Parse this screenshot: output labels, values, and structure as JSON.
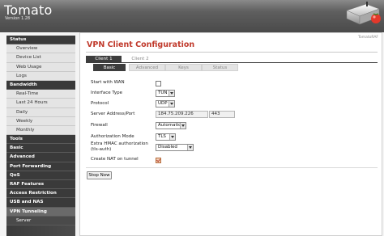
{
  "header": {
    "title": "Tomato",
    "version": "Version 1.28"
  },
  "sidebar": {
    "items": [
      {
        "label": "Status",
        "kind": "head"
      },
      {
        "label": "Overview",
        "kind": "sub"
      },
      {
        "label": "Device List",
        "kind": "sub"
      },
      {
        "label": "Web Usage",
        "kind": "sub"
      },
      {
        "label": "Logs",
        "kind": "sub"
      },
      {
        "label": "Bandwidth",
        "kind": "head"
      },
      {
        "label": "Real-Time",
        "kind": "sub"
      },
      {
        "label": "Last 24 Hours",
        "kind": "sub"
      },
      {
        "label": "Daily",
        "kind": "sub"
      },
      {
        "label": "Weekly",
        "kind": "sub"
      },
      {
        "label": "Monthly",
        "kind": "sub"
      },
      {
        "label": "Tools",
        "kind": "head"
      },
      {
        "label": "Basic",
        "kind": "head"
      },
      {
        "label": "Advanced",
        "kind": "head"
      },
      {
        "label": "Port Forwarding",
        "kind": "head"
      },
      {
        "label": "QoS",
        "kind": "head"
      },
      {
        "label": "RAF Features",
        "kind": "head"
      },
      {
        "label": "Access Restriction",
        "kind": "head"
      },
      {
        "label": "USB and NAS",
        "kind": "head"
      },
      {
        "label": "VPN Tunneling",
        "kind": "head",
        "active": true
      },
      {
        "label": "Server",
        "kind": "subdark"
      }
    ]
  },
  "main": {
    "brand": "TomatoRAF",
    "title": "VPN Client Configuration",
    "tabs": [
      {
        "label": "Client 1",
        "active": true
      },
      {
        "label": "Client 2",
        "active": false
      }
    ],
    "subtabs": [
      {
        "label": "Basic",
        "active": true
      },
      {
        "label": "Advanced",
        "active": false
      },
      {
        "label": "Keys",
        "active": false
      },
      {
        "label": "Status",
        "active": false
      }
    ],
    "form": {
      "start_with_wan": {
        "label": "Start with WAN",
        "checked": false
      },
      "interface_type": {
        "label": "Interface Type",
        "value": "TUN"
      },
      "protocol": {
        "label": "Protocol",
        "value": "UDP"
      },
      "server_address": {
        "label": "Server Address/Port",
        "address": "184.75.209.226",
        "port": "443"
      },
      "firewall": {
        "label": "Firewall",
        "value": "Automatic"
      },
      "authorization_mode": {
        "label": "Authorization Mode",
        "value": "TLS"
      },
      "hmac": {
        "label_line1": "Extra HMAC authorization",
        "label_line2": "(tls-auth)",
        "value": "Disabled"
      },
      "create_nat": {
        "label": "Create NAT on tunnel",
        "checked": true
      }
    },
    "stop_button": "Stop Now"
  },
  "colors": {
    "title_red": "#c0392b",
    "tab_active": "#3d3d3d",
    "sidebar_bg": "#3a3a3a",
    "sidebar_sub_bg": "#e4e4e4"
  }
}
